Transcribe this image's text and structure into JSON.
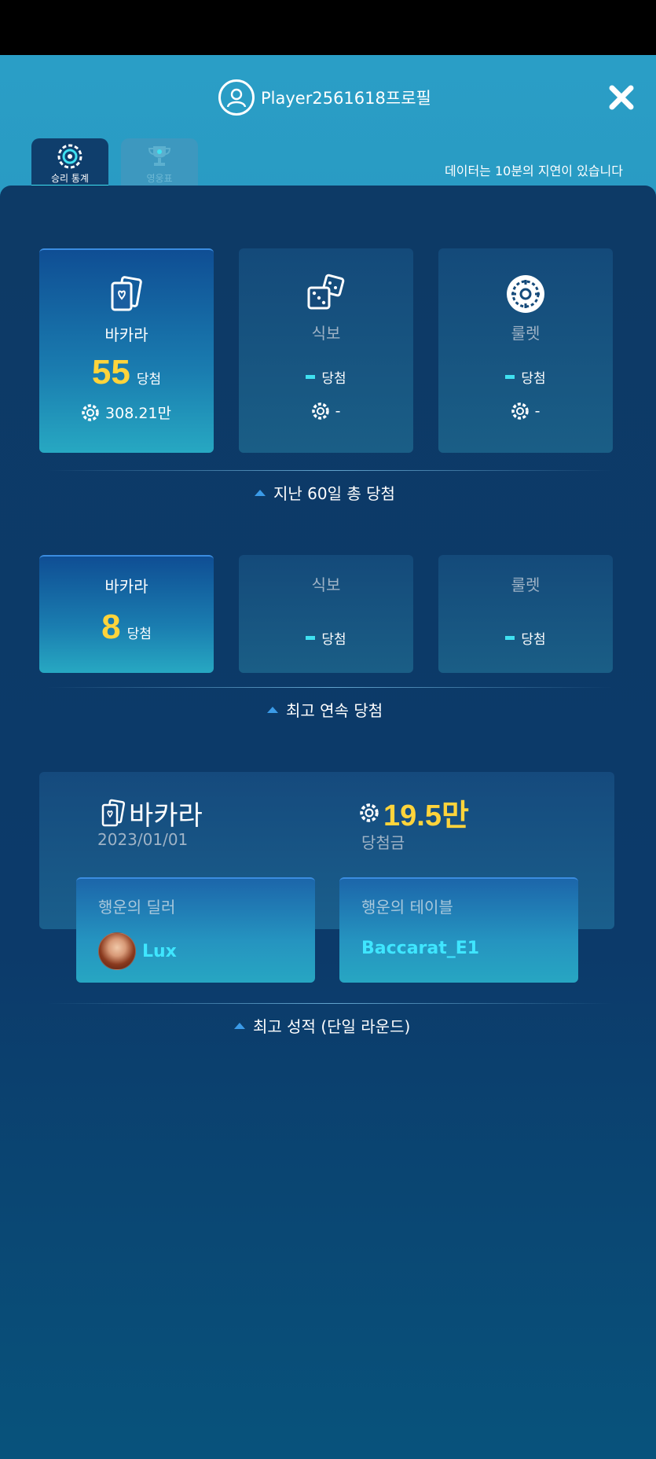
{
  "header": {
    "title": "Player2561618프로필",
    "tabs": [
      {
        "label": "승리 통계",
        "icon": "chip-icon",
        "active": true
      },
      {
        "label": "영웅표",
        "icon": "trophy-icon",
        "active": false
      }
    ],
    "delay_note": "데이터는 10분의 지연이 있습니다"
  },
  "total_wins": {
    "section_label": "지난 60일 총 당첨",
    "cards": [
      {
        "game": "바카라",
        "wins": "55",
        "wins_label": "당첨",
        "amount": "308.21만",
        "icon": "cards-icon",
        "active": true
      },
      {
        "game": "식보",
        "wins": "",
        "wins_label": "당첨",
        "amount": "-",
        "icon": "dice-icon",
        "active": false
      },
      {
        "game": "룰렛",
        "wins": "",
        "wins_label": "당첨",
        "amount": "-",
        "icon": "roulette-icon",
        "active": false
      }
    ]
  },
  "streak": {
    "section_label": "최고 연속 당첨",
    "cards": [
      {
        "game": "바카라",
        "wins": "8",
        "wins_label": "당첨",
        "active": true
      },
      {
        "game": "식보",
        "wins": "",
        "wins_label": "당첨",
        "active": false
      },
      {
        "game": "룰렛",
        "wins": "",
        "wins_label": "당첨",
        "active": false
      }
    ]
  },
  "best_round": {
    "section_label": "최고 성적 (단일 라운드)",
    "game": "바카라",
    "date": "2023/01/01",
    "amount": "19.5만",
    "amount_label": "당첨금",
    "lucky_dealer_title": "행운의 딜러",
    "lucky_dealer_name": "Lux",
    "lucky_table_title": "행운의 테이블",
    "lucky_table_name": "Baccarat_E1"
  },
  "colors": {
    "accent_yellow": "#ffd43b",
    "accent_cyan": "#3fe0f0",
    "panel_bg": "#0d3a66",
    "header_bg": "#2a9ec6"
  }
}
